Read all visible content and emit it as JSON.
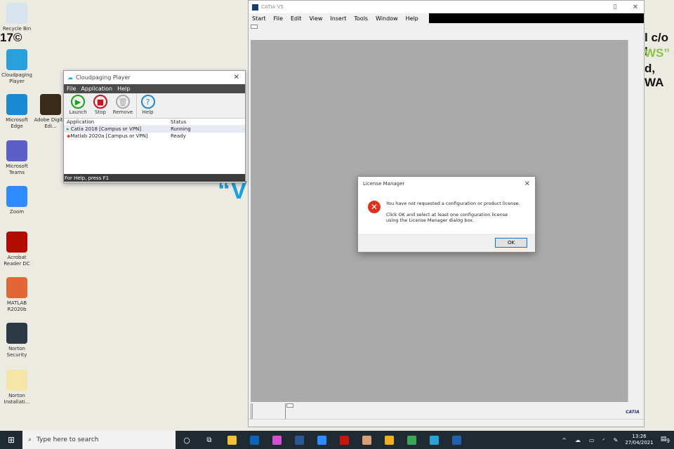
{
  "desktop": {
    "icons": [
      {
        "label": "Recycle Bin",
        "icon": "recycle-bin-icon",
        "color": "#d8e4ee"
      },
      {
        "label": "Cloudpaging Player",
        "icon": "cloudpaging-icon",
        "color": "#2aa0d8"
      },
      {
        "label": "Microsoft Edge",
        "icon": "edge-icon",
        "color": "#1a8ad4"
      },
      {
        "label": "Adobe Digital Edi...",
        "icon": "adobe-digital-editions-icon",
        "color": "#3a2a1a"
      },
      {
        "label": "Microsoft Teams",
        "icon": "teams-icon",
        "color": "#5b5fc7"
      },
      {
        "label": "Zoom",
        "icon": "zoom-icon",
        "color": "#2d8cff"
      },
      {
        "label": "Acrobat Reader DC",
        "icon": "acrobat-icon",
        "color": "#b30b00"
      },
      {
        "label": "MATLAB R2020b",
        "icon": "matlab-icon",
        "color": "#e16737"
      },
      {
        "label": "Norton Security",
        "icon": "norton-icon",
        "color": "#2b3a44"
      },
      {
        "label": "Norton Installati...",
        "icon": "folder-icon",
        "color": "#f5e6a8"
      }
    ],
    "background_text": [
      "17©",
      "l c/o l",
      "WS”",
      "d, WA",
      "“V"
    ]
  },
  "catia": {
    "title": "CATIA V5",
    "menu": [
      "Start",
      "File",
      "Edit",
      "View",
      "Insert",
      "Tools",
      "Window",
      "Help"
    ],
    "logo": "CATIA"
  },
  "cloudpaging": {
    "title": "Cloudpaging Player",
    "menu": [
      "File",
      "Application",
      "Help"
    ],
    "toolbar": [
      {
        "label": "Launch",
        "color": "#1aa31a",
        "glyph": "▶"
      },
      {
        "label": "Stop",
        "color": "#c8141e",
        "glyph": "■"
      },
      {
        "label": "Remove",
        "color": "#aaaaaa",
        "glyph": "🗑"
      },
      {
        "label": "Help",
        "color": "#1e8ac8",
        "glyph": "?"
      }
    ],
    "columns": [
      "Application",
      "Status"
    ],
    "rows": [
      {
        "app": "Catia 2018 [Campus or VPN]",
        "status": "Running"
      },
      {
        "app": "Matlab 2020a [Campus or VPN]",
        "status": "Ready"
      }
    ],
    "statusbar": "For Help, press F1"
  },
  "dialog": {
    "title": "License  Manager",
    "line1": "You have not requested a configuration or product license.",
    "line2": "Click OK and select at least one configuration license",
    "line3": "using the License Manager dialog box.",
    "ok": "OK"
  },
  "taskbar": {
    "search_placeholder": "Type here to search",
    "time": "13:26",
    "date": "27/04/2021",
    "notifications": "9",
    "apps": [
      {
        "name": "file-explorer-icon",
        "color": "#f3c03a"
      },
      {
        "name": "outlook-icon",
        "color": "#0a64b8"
      },
      {
        "name": "itunes-icon",
        "color": "#d64fd0"
      },
      {
        "name": "word-icon",
        "color": "#2b5797"
      },
      {
        "name": "zoom-icon",
        "color": "#2d8cff"
      },
      {
        "name": "acrobat-icon",
        "color": "#c4170b"
      },
      {
        "name": "photos-icon",
        "color": "#d8a070"
      },
      {
        "name": "norton-icon",
        "color": "#f2b021"
      },
      {
        "name": "chrome-icon",
        "color": "#3aa657"
      },
      {
        "name": "cloudpaging-icon",
        "color": "#2aa0d8"
      },
      {
        "name": "catia-icon",
        "color": "#2060b0"
      }
    ]
  }
}
